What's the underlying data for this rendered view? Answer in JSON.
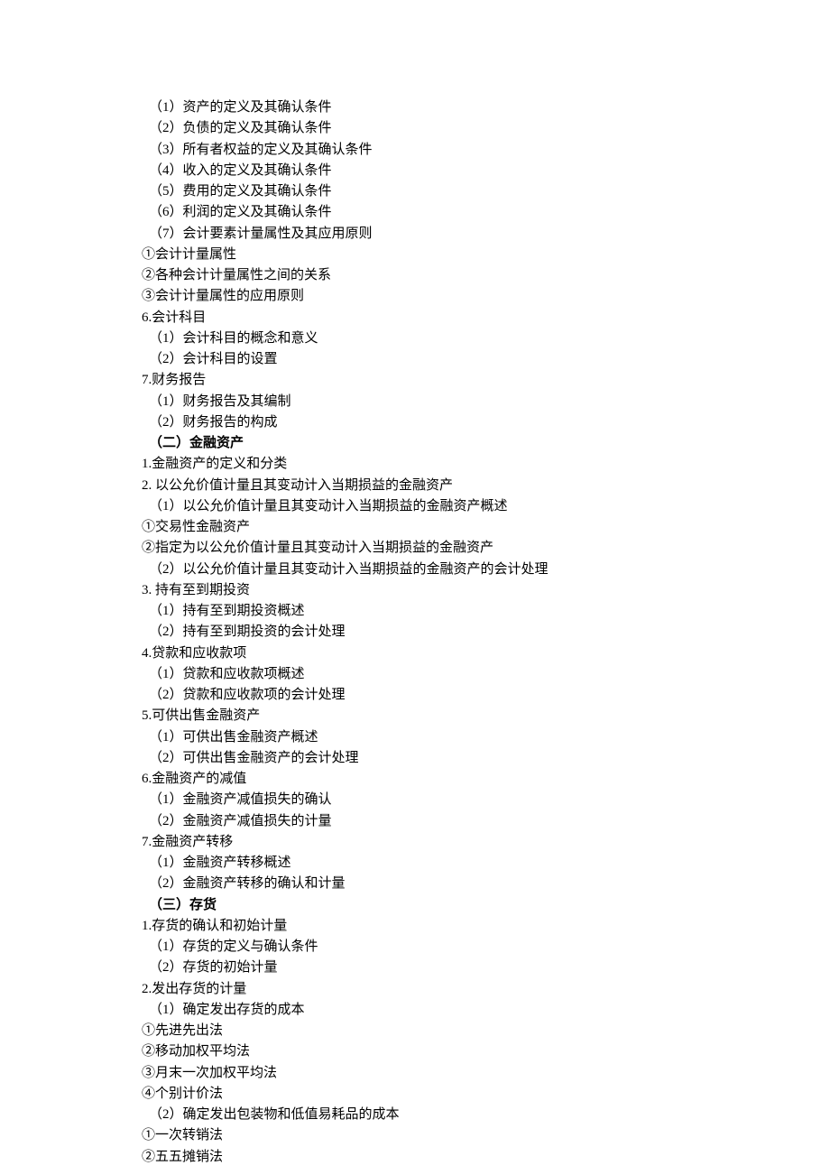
{
  "lines": [
    {
      "text": "（1）资产的定义及其确认条件",
      "indent": 1
    },
    {
      "text": "（2）负债的定义及其确认条件",
      "indent": 1
    },
    {
      "text": "（3）所有者权益的定义及其确认条件",
      "indent": 1
    },
    {
      "text": "（4）收入的定义及其确认条件",
      "indent": 1
    },
    {
      "text": "（5）费用的定义及其确认条件",
      "indent": 1
    },
    {
      "text": "（6）利润的定义及其确认条件",
      "indent": 1
    },
    {
      "text": "（7）会计要素计量属性及其应用原则",
      "indent": 1
    },
    {
      "text": "①会计计量属性",
      "indent": 0
    },
    {
      "text": "②各种会计计量属性之间的关系",
      "indent": 0
    },
    {
      "text": "③会计计量属性的应用原则",
      "indent": 0
    },
    {
      "text": "6.会计科目",
      "indent": 0
    },
    {
      "text": "（1）会计科目的概念和意义",
      "indent": 1
    },
    {
      "text": "（2）会计科目的设置",
      "indent": 1
    },
    {
      "text": "7.财务报告",
      "indent": 0
    },
    {
      "text": "（1）财务报告及其编制",
      "indent": 1
    },
    {
      "text": "（2）财务报告的构成",
      "indent": 1
    },
    {
      "text": "（二）金融资产",
      "indent": 1,
      "bold": true
    },
    {
      "text": "1.金融资产的定义和分类",
      "indent": 0
    },
    {
      "text": "2. 以公允价值计量且其变动计入当期损益的金融资产",
      "indent": 0
    },
    {
      "text": "（1）以公允价值计量且其变动计入当期损益的金融资产概述",
      "indent": 1
    },
    {
      "text": "①交易性金融资产",
      "indent": 0
    },
    {
      "text": "②指定为以公允价值计量且其变动计入当期损益的金融资产",
      "indent": 0
    },
    {
      "text": "（2）以公允价值计量且其变动计入当期损益的金融资产的会计处理",
      "indent": 1
    },
    {
      "text": "3. 持有至到期投资",
      "indent": 0
    },
    {
      "text": "（1）持有至到期投资概述",
      "indent": 1
    },
    {
      "text": "（2）持有至到期投资的会计处理",
      "indent": 1
    },
    {
      "text": "4.贷款和应收款项",
      "indent": 0
    },
    {
      "text": "（1）贷款和应收款项概述",
      "indent": 1
    },
    {
      "text": "（2）贷款和应收款项的会计处理",
      "indent": 1
    },
    {
      "text": "5.可供出售金融资产",
      "indent": 0
    },
    {
      "text": "（1）可供出售金融资产概述",
      "indent": 1
    },
    {
      "text": "（2）可供出售金融资产的会计处理",
      "indent": 1
    },
    {
      "text": "6.金融资产的减值",
      "indent": 0
    },
    {
      "text": "（1）金融资产减值损失的确认",
      "indent": 1
    },
    {
      "text": "（2）金融资产减值损失的计量",
      "indent": 1
    },
    {
      "text": "7.金融资产转移",
      "indent": 0
    },
    {
      "text": "（1）金融资产转移概述",
      "indent": 1
    },
    {
      "text": "（2）金融资产转移的确认和计量",
      "indent": 1
    },
    {
      "text": "（三）存货",
      "indent": 1,
      "bold": true
    },
    {
      "text": "1.存货的确认和初始计量",
      "indent": 0
    },
    {
      "text": "（1）存货的定义与确认条件",
      "indent": 1
    },
    {
      "text": "（2）存货的初始计量",
      "indent": 1
    },
    {
      "text": "2.发出存货的计量",
      "indent": 0
    },
    {
      "text": "（1）确定发出存货的成本",
      "indent": 1
    },
    {
      "text": "①先进先出法",
      "indent": 0
    },
    {
      "text": "②移动加权平均法",
      "indent": 0
    },
    {
      "text": "③月末一次加权平均法",
      "indent": 0
    },
    {
      "text": "④个别计价法",
      "indent": 0
    },
    {
      "text": "（2）确定发出包装物和低值易耗品的成本",
      "indent": 1
    },
    {
      "text": "①一次转销法",
      "indent": 0
    },
    {
      "text": "②五五摊销法",
      "indent": 0
    }
  ]
}
